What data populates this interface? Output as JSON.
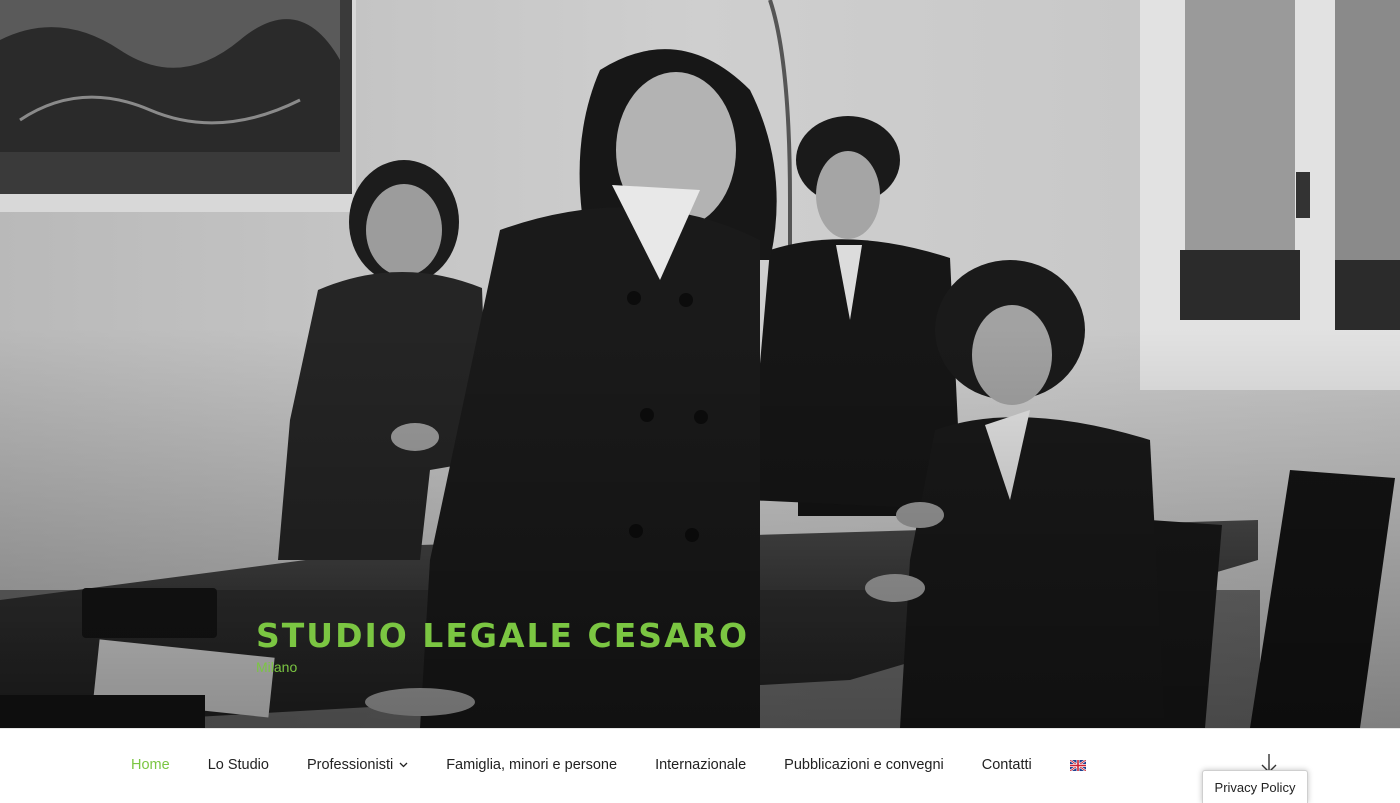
{
  "site": {
    "title": "STUDIO LEGALE CESARO",
    "description": "Milano"
  },
  "nav": {
    "items": [
      {
        "label": "Home",
        "active": true
      },
      {
        "label": "Lo Studio"
      },
      {
        "label": "Professionisti",
        "has_submenu": true
      },
      {
        "label": "Famiglia, minori e persone"
      },
      {
        "label": "Internazionale"
      },
      {
        "label": "Pubblicazioni e convegni"
      },
      {
        "label": "Contatti"
      }
    ],
    "language_icon": "uk-flag-icon"
  },
  "privacy": {
    "label": "Privacy Policy"
  },
  "colors": {
    "accent": "#7bc642",
    "text": "#222222"
  }
}
